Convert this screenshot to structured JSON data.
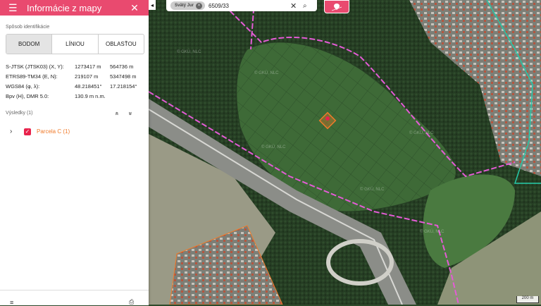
{
  "header": {
    "title": "Informácie z mapy",
    "menu_icon": "☰",
    "close_icon": "✕"
  },
  "identification": {
    "label": "Spôsob identifikácie",
    "modes": [
      "BODOM",
      "LÍNIOU",
      "OBLASŤOU"
    ],
    "selected": "BODOM"
  },
  "coords": [
    {
      "label": "S-JTSK (JTSK03) (X, Y):",
      "v1": "1273417 m",
      "v2": "564736 m"
    },
    {
      "label": "ETRS89-TM34 (E, N):",
      "v1": "219107 m",
      "v2": "5347498 m"
    },
    {
      "label": "WGS84 (φ, λ):",
      "v1": "48.218451°",
      "v2": "17.218154°"
    },
    {
      "label": "Bpv (H), DMR 5.0:",
      "v1": "130.9 m n.m.",
      "v2": ""
    }
  ],
  "results": {
    "label": "Výsledky (1)",
    "collapse_all_icon": "«",
    "expand_all_icon": "»",
    "items": [
      {
        "label": "Parcela C (1)",
        "checked": true
      }
    ]
  },
  "search": {
    "chip": "Svätý Jur",
    "query": "6509/33",
    "clear_icon": "✕",
    "search_icon": "⌕"
  },
  "map": {
    "watermark": "© GKÚ, NLC",
    "scale": "200 m",
    "colors": {
      "forest": "#2b4428",
      "field": "#3f6b38",
      "highlight": "#e45bd6",
      "parcel_outline": "#f07a2a",
      "residential": "#8a8f86"
    }
  },
  "colors": {
    "accent": "#e94a6f"
  }
}
